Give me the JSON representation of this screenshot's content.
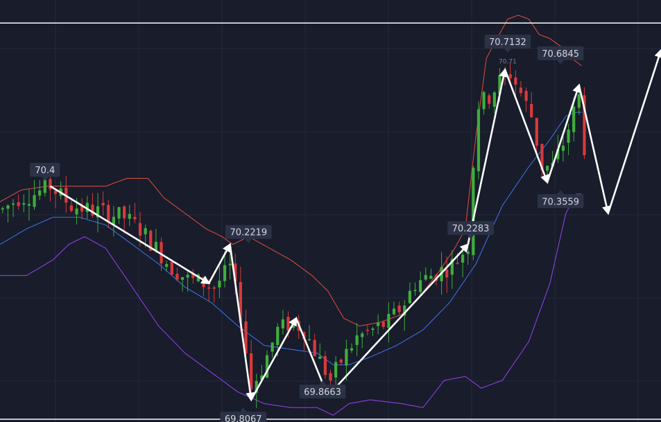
{
  "colors": {
    "background": "#181c2b",
    "grid": "#242a3c",
    "up": "#3fae3c",
    "down": "#d93a3a",
    "bb_upper": "#d24a3c",
    "bb_middle": "#3e6fd8",
    "bb_lower": "#8e3fe0",
    "arrow": "#ffffff",
    "hline": "#ffffff"
  },
  "chart_data": {
    "type": "candlestick",
    "title": "",
    "xlabel": "",
    "ylabel": "",
    "grid": true,
    "ylim": [
      69.77,
      70.81
    ],
    "x_count": 125,
    "horizontal_lines": [
      70.79,
      69.77
    ],
    "price_labels": [
      {
        "text": "70.4",
        "x": 8.5,
        "y": 70.38,
        "dir": "down"
      },
      {
        "text": "70.2219",
        "x": 47,
        "y": 70.22,
        "dir": "down"
      },
      {
        "text": "69.8067",
        "x": 46,
        "y": 69.8,
        "dir": "up"
      },
      {
        "text": "69.8663",
        "x": 61,
        "y": 69.87,
        "dir": "up"
      },
      {
        "text": "70.2283",
        "x": 89,
        "y": 70.23,
        "dir": "down"
      },
      {
        "text": "70.7132",
        "x": 96,
        "y": 70.71,
        "dir": "down"
      },
      {
        "text": "70.6845",
        "x": 106,
        "y": 70.68,
        "dir": "down"
      },
      {
        "text": "70.3559",
        "x": 106,
        "y": 70.36,
        "dir": "up"
      }
    ],
    "small_labels": [
      {
        "text": "70.71",
        "x": 96,
        "y": 70.7
      }
    ],
    "arrows": [
      [
        [
          9.5,
          70.37
        ],
        [
          39.5,
          70.12
        ]
      ],
      [
        [
          39.5,
          70.12
        ],
        [
          43.5,
          70.22
        ]
      ],
      [
        [
          43.5,
          70.22
        ],
        [
          47.5,
          69.82
        ]
      ],
      [
        [
          47.5,
          69.82
        ],
        [
          56.0,
          70.03
        ]
      ],
      [
        [
          56.0,
          70.03
        ],
        [
          62.0,
          69.83
        ]
      ],
      [
        [
          62.0,
          69.83
        ],
        [
          88.5,
          70.22
        ]
      ],
      [
        [
          88.5,
          70.22
        ],
        [
          95.5,
          70.67
        ]
      ],
      [
        [
          95.5,
          70.67
        ],
        [
          103.5,
          70.38
        ]
      ],
      [
        [
          103.5,
          70.38
        ],
        [
          109.5,
          70.63
        ]
      ],
      [
        [
          109.5,
          70.63
        ],
        [
          115.0,
          70.3
        ]
      ],
      [
        [
          115.0,
          70.3
        ],
        [
          125.0,
          70.72
        ]
      ]
    ],
    "anchors": {
      "close": [
        [
          0,
          70.31
        ],
        [
          3,
          70.34
        ],
        [
          6,
          70.35
        ],
        [
          9,
          70.37
        ],
        [
          13,
          70.32
        ],
        [
          16,
          70.31
        ],
        [
          20,
          70.3
        ],
        [
          23,
          70.29
        ],
        [
          26,
          70.26
        ],
        [
          29,
          70.21
        ],
        [
          32,
          70.16
        ],
        [
          35,
          70.13
        ],
        [
          38,
          70.12
        ],
        [
          40,
          70.11
        ],
        [
          43,
          70.16
        ],
        [
          45,
          70.04
        ],
        [
          47,
          69.85
        ],
        [
          49,
          69.9
        ],
        [
          52,
          70.0
        ],
        [
          55,
          70.02
        ],
        [
          57,
          70.0
        ],
        [
          60,
          69.92
        ],
        [
          62,
          69.87
        ],
        [
          64,
          69.92
        ],
        [
          67,
          69.98
        ],
        [
          70,
          70.0
        ],
        [
          73,
          70.02
        ],
        [
          76,
          70.07
        ],
        [
          78,
          70.12
        ],
        [
          81,
          70.14
        ],
        [
          84,
          70.16
        ],
        [
          86,
          70.18
        ],
        [
          88,
          70.22
        ],
        [
          89,
          70.43
        ],
        [
          90,
          70.58
        ],
        [
          92,
          70.6
        ],
        [
          94,
          70.64
        ],
        [
          96,
          70.66
        ],
        [
          98,
          70.61
        ],
        [
          100,
          70.55
        ],
        [
          102,
          70.42
        ],
        [
          104,
          70.42
        ],
        [
          106,
          70.48
        ],
        [
          108,
          70.56
        ],
        [
          109,
          70.6
        ],
        [
          110,
          70.47
        ]
      ],
      "bb_upper": [
        [
          0,
          70.33
        ],
        [
          4,
          70.36
        ],
        [
          9,
          70.37
        ],
        [
          14,
          70.37
        ],
        [
          20,
          70.37
        ],
        [
          24,
          70.39
        ],
        [
          28,
          70.39
        ],
        [
          31,
          70.34
        ],
        [
          35,
          70.3
        ],
        [
          39,
          70.26
        ],
        [
          42,
          70.24
        ],
        [
          44,
          70.22
        ],
        [
          47,
          70.24
        ],
        [
          51,
          70.21
        ],
        [
          55,
          70.18
        ],
        [
          59,
          70.14
        ],
        [
          62,
          70.1
        ],
        [
          65,
          70.03
        ],
        [
          68,
          70.01
        ],
        [
          72,
          70.02
        ],
        [
          76,
          70.04
        ],
        [
          79,
          70.08
        ],
        [
          83,
          70.15
        ],
        [
          86,
          70.21
        ],
        [
          88,
          70.26
        ],
        [
          90,
          70.5
        ],
        [
          92,
          70.7
        ],
        [
          94,
          70.75
        ],
        [
          96,
          70.8
        ],
        [
          98,
          70.81
        ],
        [
          100,
          70.8
        ],
        [
          102,
          70.76
        ],
        [
          104,
          70.75
        ],
        [
          106,
          70.73
        ],
        [
          108,
          70.7
        ],
        [
          109,
          70.69
        ],
        [
          110,
          70.68
        ]
      ],
      "bb_middle": [
        [
          0,
          70.22
        ],
        [
          5,
          70.26
        ],
        [
          10,
          70.29
        ],
        [
          15,
          70.29
        ],
        [
          20,
          70.27
        ],
        [
          25,
          70.22
        ],
        [
          30,
          70.17
        ],
        [
          35,
          70.11
        ],
        [
          40,
          70.07
        ],
        [
          45,
          70.01
        ],
        [
          50,
          69.96
        ],
        [
          55,
          69.95
        ],
        [
          60,
          69.94
        ],
        [
          63,
          69.91
        ],
        [
          66,
          69.91
        ],
        [
          70,
          69.93
        ],
        [
          75,
          69.96
        ],
        [
          80,
          70.0
        ],
        [
          85,
          70.07
        ],
        [
          90,
          70.17
        ],
        [
          95,
          70.32
        ],
        [
          100,
          70.42
        ],
        [
          104,
          70.49
        ],
        [
          107,
          70.55
        ],
        [
          109,
          70.56
        ],
        [
          110,
          70.56
        ]
      ],
      "bb_lower": [
        [
          0,
          70.14
        ],
        [
          5,
          70.14
        ],
        [
          10,
          70.18
        ],
        [
          13,
          70.22
        ],
        [
          16,
          70.24
        ],
        [
          20,
          70.21
        ],
        [
          25,
          70.11
        ],
        [
          30,
          70.01
        ],
        [
          35,
          69.94
        ],
        [
          40,
          69.89
        ],
        [
          45,
          69.84
        ],
        [
          50,
          69.81
        ],
        [
          55,
          69.8
        ],
        [
          60,
          69.8
        ],
        [
          63,
          69.78
        ],
        [
          66,
          69.81
        ],
        [
          70,
          69.82
        ],
        [
          76,
          69.81
        ],
        [
          80,
          69.8
        ],
        [
          84,
          69.87
        ],
        [
          88,
          69.88
        ],
        [
          91,
          69.85
        ],
        [
          95,
          69.87
        ],
        [
          100,
          69.97
        ],
        [
          104,
          70.12
        ],
        [
          107,
          70.3
        ],
        [
          109,
          70.35
        ],
        [
          110,
          70.35
        ]
      ]
    }
  }
}
